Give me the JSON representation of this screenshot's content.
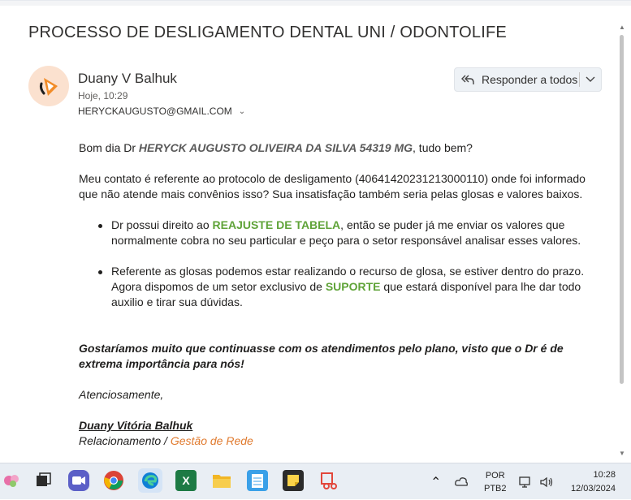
{
  "email": {
    "subject": "PROCESSO DE DESLIGAMENTO DENTAL UNI / ODONTOLIFE",
    "sender_name": "Duany V Balhuk",
    "sent_time": "Hoje, 10:29",
    "recipient": "HERYCKAUGUSTO@GMAIL.COM",
    "reply_all_label": "Responder a todos"
  },
  "body": {
    "greeting_pre": "Bom dia Dr ",
    "greeting_name": "HERYCK AUGUSTO OLIVEIRA DA SILVA 54319 MG",
    "greeting_post": ", tudo bem?",
    "para1": "Meu contato é referente ao protocolo de desligamento (40641420231213000110) onde foi informado que não atende mais convênios isso? Sua insatisfação também seria pelas glosas e valores baixos.",
    "bullet1_pre": "Dr possui direito ao ",
    "bullet1_highlight": "REAJUSTE DE TABELA",
    "bullet1_post": ", então se puder já me enviar os valores que normalmente cobra no seu particular e peço para o setor responsável analisar esses valores.",
    "bullet2_pre": "Referente as glosas podemos estar realizando o recurso de glosa, se estiver dentro do prazo. Agora dispomos de um setor exclusivo de ",
    "bullet2_highlight": "SUPORTE",
    "bullet2_post": " que estará disponível para lhe dar todo auxilio e tirar sua dúvidas.",
    "closing": "Gostaríamos muito que continuasse com os atendimentos pelo plano, visto que o Dr é de extrema importância para nós!",
    "regards": "Atenciosamente,",
    "signature_name": "Duany Vitória Balhuk ",
    "signature_role_pre": "Relacionamento / ",
    "signature_role_highlight": "Gestão de Rede"
  },
  "taskbar": {
    "language": "POR",
    "layout": "PTB2",
    "time": "10:28",
    "date": "12/03/2024",
    "apps": [
      "widgets-icon",
      "task-view-icon",
      "teams-icon",
      "chrome-icon",
      "edge-icon",
      "excel-icon",
      "file-explorer-icon",
      "notepad-icon",
      "sticky-notes-icon",
      "snipping-tool-icon"
    ]
  },
  "colors": {
    "highlight_green": "#5fa338",
    "signature_orange": "#e07a2e",
    "avatar_bg": "#fbe1cf"
  }
}
